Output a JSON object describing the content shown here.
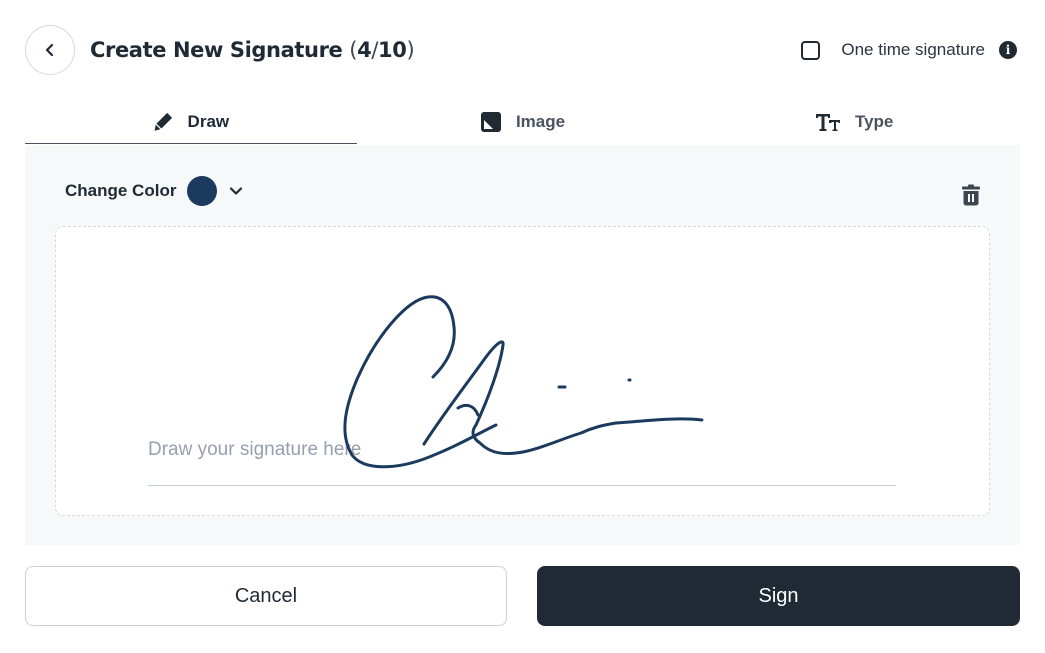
{
  "header": {
    "title": "Create New Signature",
    "count_open": "(",
    "count_current": "4",
    "count_sep": "/",
    "count_total": "10",
    "count_close": ")"
  },
  "one_time": {
    "label": "One time signature",
    "checked": false,
    "info_glyph": "i"
  },
  "tabs": [
    {
      "label": "Draw",
      "icon": "pencil-icon",
      "active": true
    },
    {
      "label": "Image",
      "icon": "image-icon",
      "active": false
    },
    {
      "label": "Type",
      "icon": "text-size-icon",
      "active": false
    }
  ],
  "toolbar": {
    "change_color_label": "Change Color",
    "selected_color": "#1b3a5e"
  },
  "canvas": {
    "placeholder": "Draw your signature here",
    "stroke_color": "#1b3a5e"
  },
  "actions": {
    "cancel_label": "Cancel",
    "sign_label": "Sign"
  }
}
